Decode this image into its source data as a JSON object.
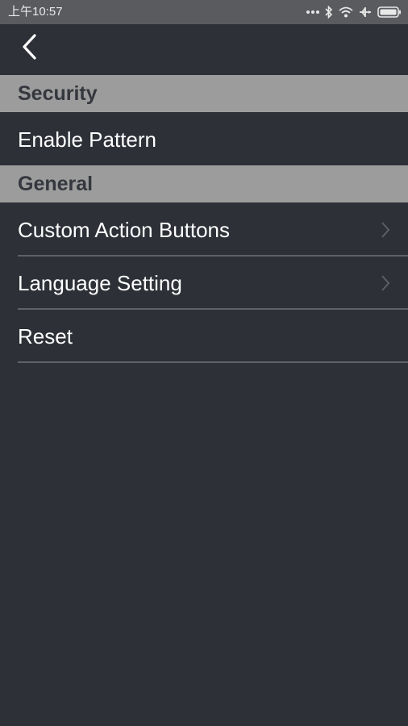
{
  "status_bar": {
    "time": "上午10:57",
    "icons": [
      "more-dots-icon",
      "bluetooth-icon",
      "wifi-icon",
      "airplane-icon",
      "battery-icon"
    ]
  },
  "app_bar": {
    "back_icon": "back-chevron-icon"
  },
  "sections": {
    "security": {
      "title": "Security",
      "items": [
        {
          "label": "Enable Pattern"
        }
      ]
    },
    "general": {
      "title": "General",
      "items": [
        {
          "label": "Custom Action Buttons",
          "icon": "chevron-right-icon"
        },
        {
          "label": "Language Setting",
          "icon": "chevron-right-icon"
        },
        {
          "label": "Reset"
        }
      ]
    }
  },
  "colors": {
    "background": "#2d3037",
    "section_header_bg": "#9c9c9c",
    "section_header_text": "#34373d",
    "status_bar_bg": "#595b5f",
    "divider": "#5f6166"
  }
}
